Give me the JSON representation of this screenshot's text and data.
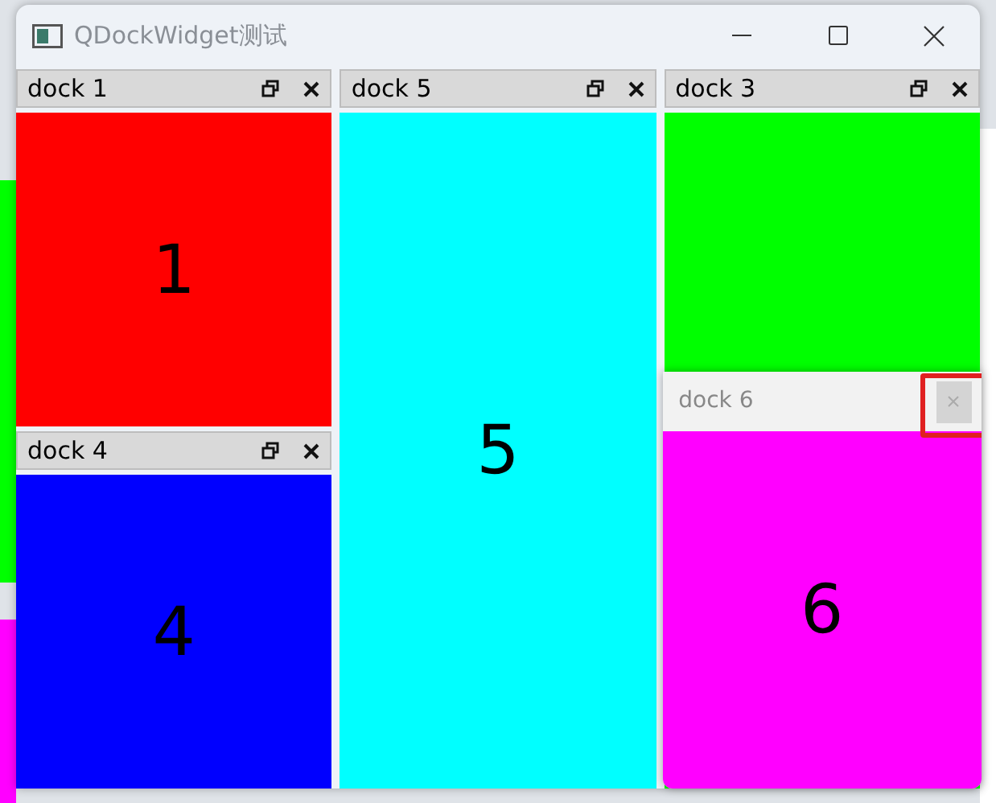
{
  "window": {
    "title": "QDockWidget测试"
  },
  "columns": [
    {
      "docks": [
        {
          "title": "dock 1",
          "label": "1",
          "color": "#ff0000"
        },
        {
          "title": "dock 4",
          "label": "4",
          "color": "#0000ff"
        }
      ]
    },
    {
      "docks": [
        {
          "title": "dock 5",
          "label": "5",
          "color": "#00ffff"
        }
      ]
    },
    {
      "docks": [
        {
          "title": "dock 3",
          "color": "#00ff00"
        }
      ]
    }
  ],
  "floating_dock": {
    "title": "dock 6",
    "label": "6",
    "color": "#ff00ff",
    "close_highlighted": true
  }
}
